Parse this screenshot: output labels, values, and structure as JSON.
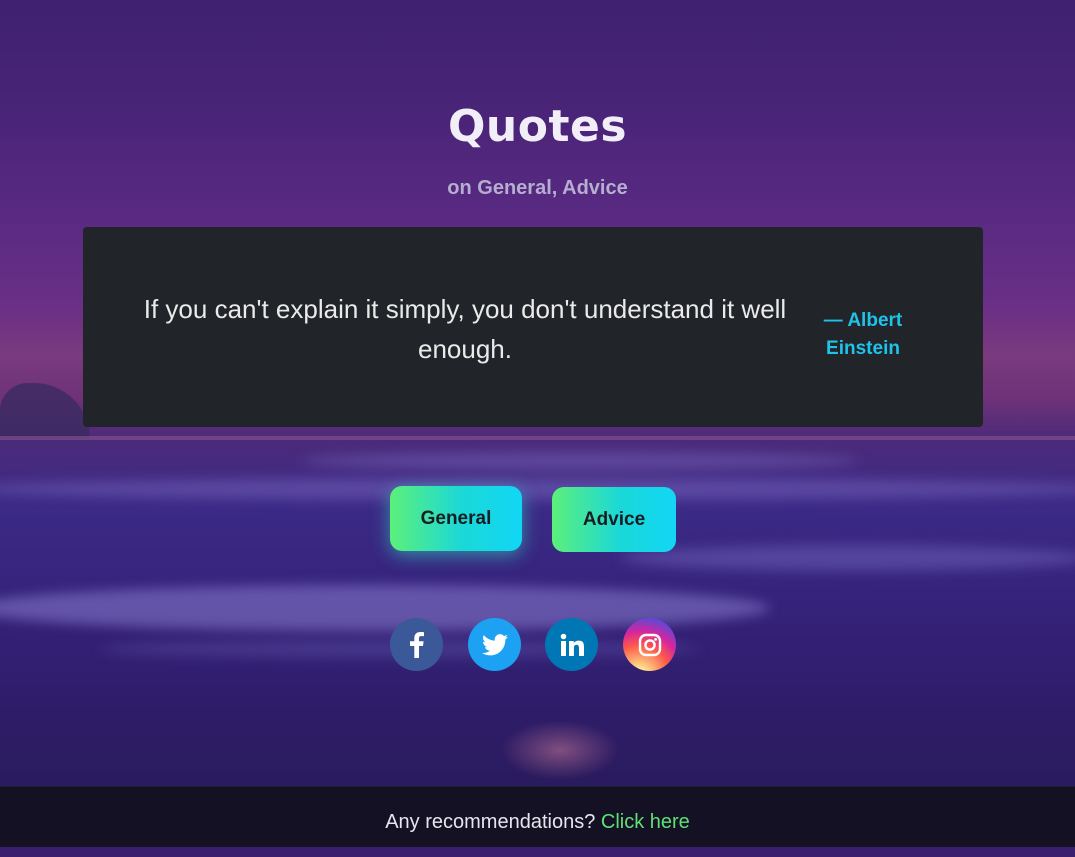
{
  "header": {
    "title": "Quotes",
    "subtitle": "on General, Advice"
  },
  "quote": {
    "text": "If you can't explain it simply, you don't understand it well enough.",
    "author": "— Albert Einstein"
  },
  "tags": [
    {
      "label": "General"
    },
    {
      "label": "Advice"
    }
  ],
  "socials": [
    {
      "name": "facebook",
      "icon": "facebook-icon",
      "color": "#3b5998"
    },
    {
      "name": "twitter",
      "icon": "twitter-icon",
      "color": "#1da1f2"
    },
    {
      "name": "linkedin",
      "icon": "linkedin-icon",
      "color": "#0077b5"
    },
    {
      "name": "instagram",
      "icon": "instagram-icon",
      "color": "#d6249f"
    }
  ],
  "footer": {
    "prompt": "Any recommendations?",
    "link_label": "Click here"
  },
  "colors": {
    "accent": "#1fc2e8",
    "link": "#5fe074",
    "card": "#212428"
  }
}
